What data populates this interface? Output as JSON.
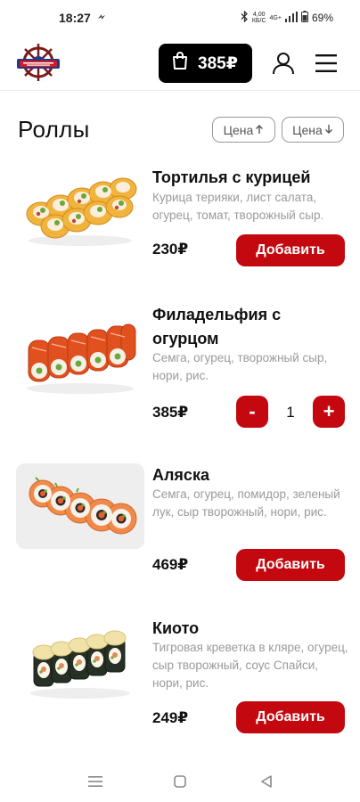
{
  "status_bar": {
    "time": "18:27",
    "speed_value": "4,00",
    "speed_unit": "КБ/С",
    "network": "4G+",
    "battery": "69%"
  },
  "header": {
    "cart_total": "385₽"
  },
  "catalog": {
    "title": "Роллы",
    "sort_asc_label": "Цена",
    "sort_desc_label": "Цена"
  },
  "products": [
    {
      "name": "Тортилья с курицей",
      "description": "Курица терияки, лист салата, огурец, томат, творожный сыр.",
      "price": "230₽",
      "button_label": "Добавить"
    },
    {
      "name": "Филадельфия с огурцом",
      "description": "Семга, огурец, творожный сыр, нори, рис.",
      "price": "385₽",
      "quantity": "1",
      "minus_label": "-",
      "plus_label": "+"
    },
    {
      "name": "Аляска",
      "description": "Семга, огурец, помидор, зеленый лук, сыр творожный, нори, рис.",
      "price": "469₽",
      "button_label": "Добавить"
    },
    {
      "name": "Киото",
      "description": "Тигровая креветка в кляре, огурец, сыр творожный, соус Спайси, нори, рис.",
      "price": "249₽",
      "button_label": "Добавить"
    }
  ],
  "colors": {
    "accent": "#c3090f",
    "cart_background": "#000000",
    "description_text": "#9a9a9a"
  }
}
